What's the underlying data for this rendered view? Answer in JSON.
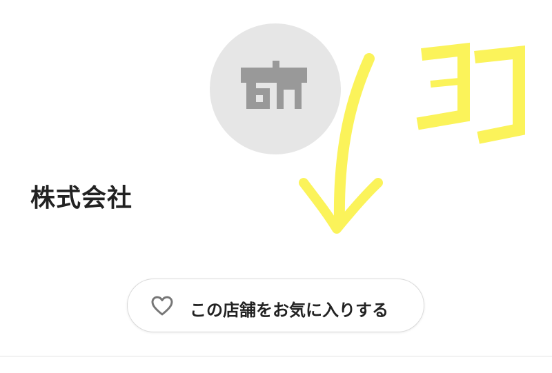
{
  "shop": {
    "icon": "storefront-icon",
    "name": "株式会社"
  },
  "favorite_button": {
    "icon": "heart-outline-icon",
    "label": "この店舗をお気に入りする"
  },
  "annotation": {
    "text": "ココ",
    "arrow_icon": "hand-drawn-down-arrow-icon",
    "color": "#fbf35a"
  },
  "colors": {
    "avatar_bg": "#e6e6e6",
    "icon_gray": "#999999",
    "text": "#222222",
    "border": "#d9d9d9",
    "highlight": "#fbf35a"
  }
}
